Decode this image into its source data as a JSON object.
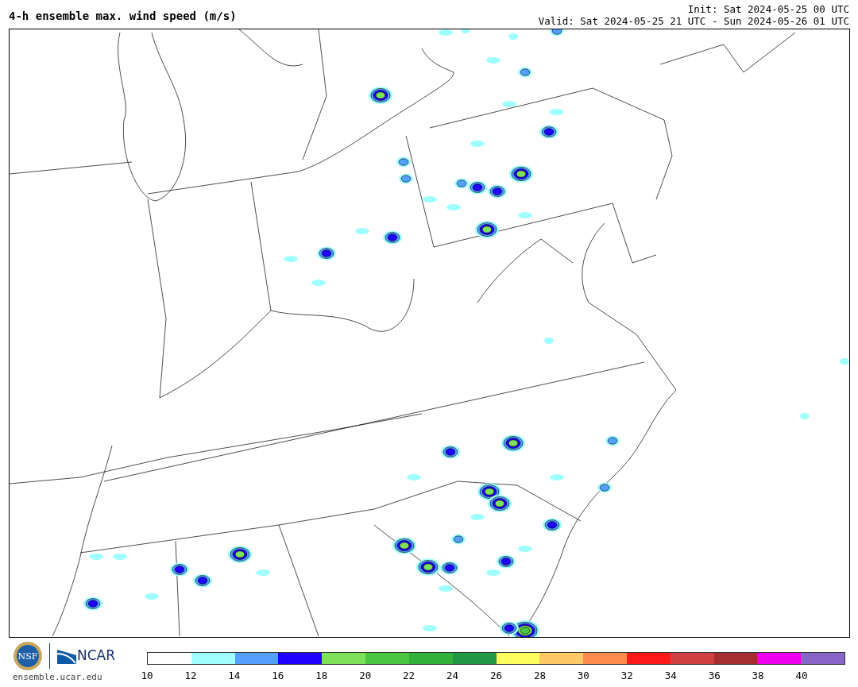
{
  "header": {
    "title": "4-h ensemble max. wind speed (m/s)",
    "init": "Init: Sat 2024-05-25 00 UTC",
    "valid": "Valid: Sat 2024-05-25 21 UTC - Sun 2024-05-26 01 UTC"
  },
  "footer": {
    "nsf_logo_text": "NSF",
    "ncar_logo_text": "NCAR",
    "url": "ensemble.ucar.edu"
  },
  "colorbar": {
    "bins": [
      {
        "color": "#ffffff"
      },
      {
        "color": "#a0fffe"
      },
      {
        "color": "#54a0ff"
      },
      {
        "color": "#1e00ff"
      },
      {
        "color": "#7ee15a"
      },
      {
        "color": "#4bc643"
      },
      {
        "color": "#31b03a"
      },
      {
        "color": "#229745"
      },
      {
        "color": "#ffff60"
      },
      {
        "color": "#ffc866"
      },
      {
        "color": "#ff8c4d"
      },
      {
        "color": "#ff1a1a"
      },
      {
        "color": "#d04040"
      },
      {
        "color": "#a52f2f"
      },
      {
        "color": "#ee00ee"
      },
      {
        "color": "#8a65c8"
      }
    ],
    "ticks": [
      "10",
      "12",
      "14",
      "16",
      "18",
      "20",
      "22",
      "24",
      "26",
      "28",
      "30",
      "32",
      "34",
      "36",
      "38",
      "40"
    ]
  }
}
